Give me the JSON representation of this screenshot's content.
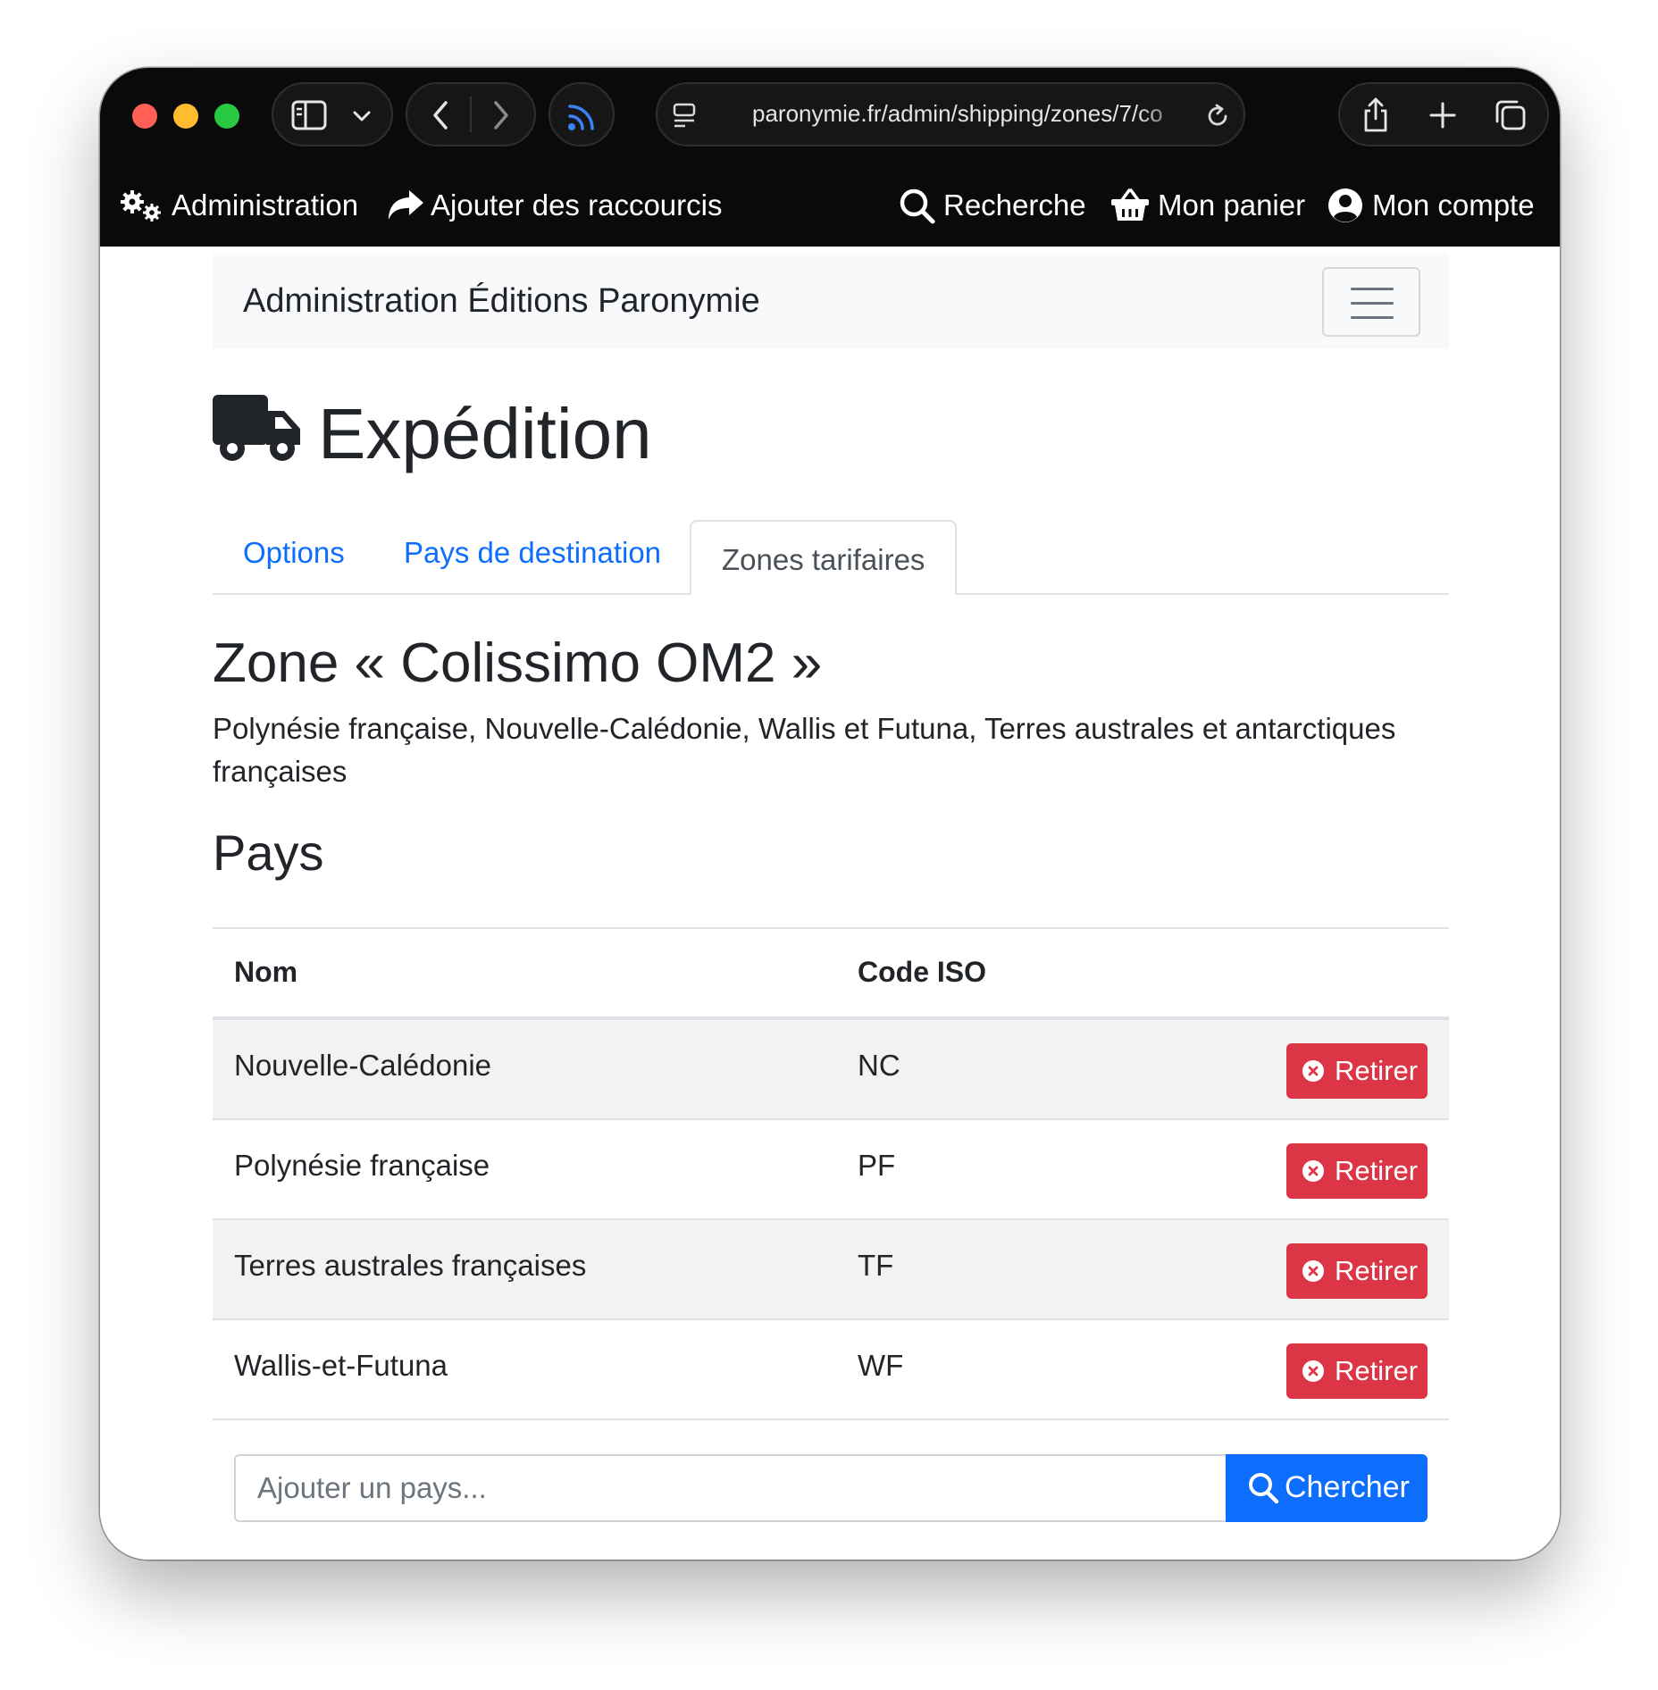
{
  "browser": {
    "url": "paronymie.fr/admin/shipping/zones/7/co"
  },
  "shortcuts_bar": {
    "administration": "Administration",
    "add_shortcuts": "Ajouter des raccourcis",
    "search": "Recherche",
    "cart": "Mon panier",
    "account": "Mon compte"
  },
  "navbar": {
    "brand": "Administration Éditions Paronymie"
  },
  "page": {
    "title": "Expédition",
    "tabs": [
      {
        "label": "Options",
        "active": false
      },
      {
        "label": "Pays de destination",
        "active": false
      },
      {
        "label": "Zones tarifaires",
        "active": true
      }
    ],
    "zone_title": "Zone « Colissimo OM2 »",
    "zone_description": "Polynésie française, Nouvelle-Calédonie, Wallis et Futuna, Terres australes et antarctiques françaises",
    "countries_heading": "Pays"
  },
  "table": {
    "headers": {
      "name": "Nom",
      "iso": "Code ISO"
    },
    "rows": [
      {
        "name": "Nouvelle-Calédonie",
        "iso": "NC",
        "action": "Retirer"
      },
      {
        "name": "Polynésie française",
        "iso": "PF",
        "action": "Retirer"
      },
      {
        "name": "Terres australes françaises",
        "iso": "TF",
        "action": "Retirer"
      },
      {
        "name": "Wallis-et-Futuna",
        "iso": "WF",
        "action": "Retirer"
      }
    ]
  },
  "add_country": {
    "placeholder": "Ajouter un pays...",
    "value": "",
    "button": "Chercher"
  },
  "colors": {
    "primary": "#0d6efd",
    "danger": "#dc3545",
    "chrome": "#0a0a0a",
    "traffic_red": "#ff5f57",
    "traffic_yellow": "#febc2e",
    "traffic_green": "#28c840"
  }
}
